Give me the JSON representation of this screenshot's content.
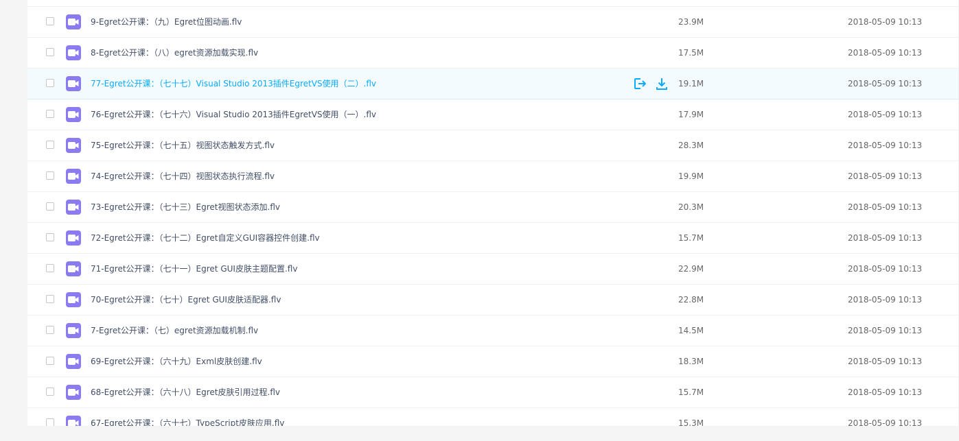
{
  "files": [
    {
      "name": "",
      "size": "",
      "date": ""
    },
    {
      "name": "9-Egret公开课：（九）Egret位图动画.flv",
      "size": "23.9M",
      "date": "2018-05-09 10:13"
    },
    {
      "name": "8-Egret公开课：（八）egret资源加载实现.flv",
      "size": "17.5M",
      "date": "2018-05-09 10:13"
    },
    {
      "name": "77-Egret公开课：（七十七）Visual Studio 2013插件EgretVS使用（二）.flv",
      "size": "19.1M",
      "date": "2018-05-09 10:13",
      "hovered": true
    },
    {
      "name": "76-Egret公开课：（七十六）Visual Studio 2013插件EgretVS使用（一）.flv",
      "size": "17.9M",
      "date": "2018-05-09 10:13"
    },
    {
      "name": "75-Egret公开课：（七十五）视图状态触发方式.flv",
      "size": "28.3M",
      "date": "2018-05-09 10:13"
    },
    {
      "name": "74-Egret公开课：（七十四）视图状态执行流程.flv",
      "size": "19.9M",
      "date": "2018-05-09 10:13"
    },
    {
      "name": "73-Egret公开课：（七十三）Egret视图状态添加.flv",
      "size": "20.3M",
      "date": "2018-05-09 10:13"
    },
    {
      "name": "72-Egret公开课：（七十二）Egret自定义GUI容器控件创建.flv",
      "size": "15.7M",
      "date": "2018-05-09 10:13"
    },
    {
      "name": "71-Egret公开课：（七十一）Egret GUI皮肤主题配置.flv",
      "size": "22.9M",
      "date": "2018-05-09 10:13"
    },
    {
      "name": "70-Egret公开课：（七十）Egret GUI皮肤适配器.flv",
      "size": "22.8M",
      "date": "2018-05-09 10:13"
    },
    {
      "name": "7-Egret公开课：（七）egret资源加载机制.flv",
      "size": "14.5M",
      "date": "2018-05-09 10:13"
    },
    {
      "name": "69-Egret公开课：（六十九）Exml皮肤创建.flv",
      "size": "18.3M",
      "date": "2018-05-09 10:13"
    },
    {
      "name": "68-Egret公开课：（六十八）Egret皮肤引用过程.flv",
      "size": "15.7M",
      "date": "2018-05-09 10:13"
    },
    {
      "name": "67-Egret公开课：（六十七）TypeScript皮肤应用.flv",
      "size": "15.3M",
      "date": "2018-05-09 10:13"
    }
  ],
  "icons": {
    "file_type": "video-file-icon",
    "share": "share-icon",
    "download": "download-icon"
  },
  "colors": {
    "video_icon": "#8a7cf0",
    "accent": "#09aaff",
    "hover_row": "#f4fbff"
  }
}
